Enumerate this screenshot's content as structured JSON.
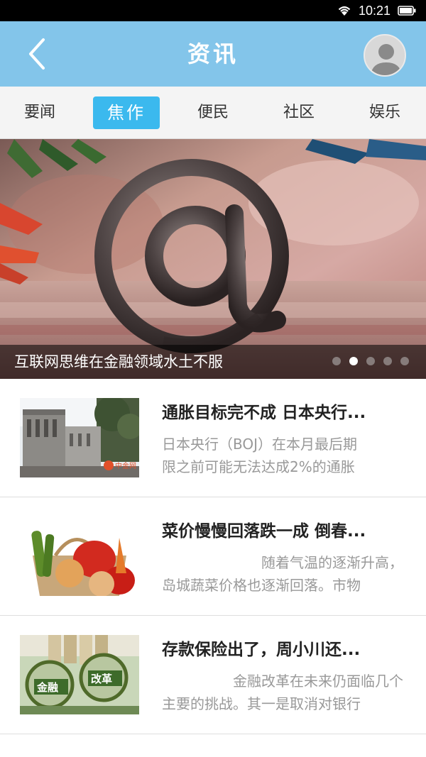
{
  "status_bar": {
    "time": "10:21",
    "wifi_icon": "wifi-icon",
    "battery_icon": "battery-icon"
  },
  "header": {
    "title": "资讯",
    "back_icon": "chevron-left-icon",
    "avatar_icon": "user-avatar-icon",
    "background": "#83c5ea"
  },
  "tabs": [
    {
      "label": "要闻",
      "active": false
    },
    {
      "label": "焦作",
      "active": true
    },
    {
      "label": "便民",
      "active": false
    },
    {
      "label": "社区",
      "active": false
    },
    {
      "label": "娱乐",
      "active": false
    }
  ],
  "banner": {
    "caption": "互联网思维在金融领域水土不服",
    "slide_count": 5,
    "active_slide": 2
  },
  "news": [
    {
      "title": "通胀目标完不成 日本央行...",
      "summary_line1": "日本央行（BOJ）在本月最后期",
      "summary_line2": "限之前可能无法达成2%的通胀",
      "thumb_watermark": "中金网"
    },
    {
      "title": "菜价慢慢回落跌一成 倒春...",
      "summary_line1": "随着气温的逐渐升高，",
      "summary_line2": "岛城蔬菜价格也逐渐回落。市物"
    },
    {
      "title": "存款保险出了，周小川还...",
      "summary_line1": "金融改革在未来仍面临几个",
      "summary_line2": "主要的挑战。其一是取消对银行",
      "thumb_label1": "金融",
      "thumb_label2": "改革"
    }
  ],
  "colors": {
    "accent": "#3bb9ee",
    "header": "#83c5ea"
  }
}
